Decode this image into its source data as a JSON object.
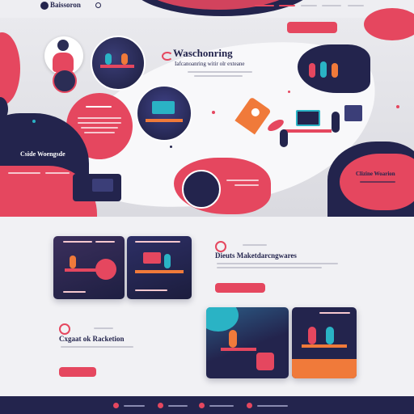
{
  "hero": {
    "brand": "Baissoron",
    "cta_top": "",
    "title": "Waschonring",
    "subtitle": "Iafcanoanring witir olr exteane",
    "left_panel_title": "Cside Woengsde",
    "right_panel_title": "Clizine Woarion"
  },
  "section2": {
    "title": "Dieuts Maketdarcngwares",
    "cta": ""
  },
  "section3": {
    "title": "Cxgaat ok Racketion",
    "cta": ""
  },
  "colors": {
    "navy": "#23244d",
    "red": "#e5475f",
    "teal": "#2ab3c5",
    "orange": "#f07a3a",
    "background": "#f1f1f4"
  },
  "icons": [
    "brand-logo-icon",
    "search-icon",
    "rocket-icon",
    "chevron-icon"
  ]
}
